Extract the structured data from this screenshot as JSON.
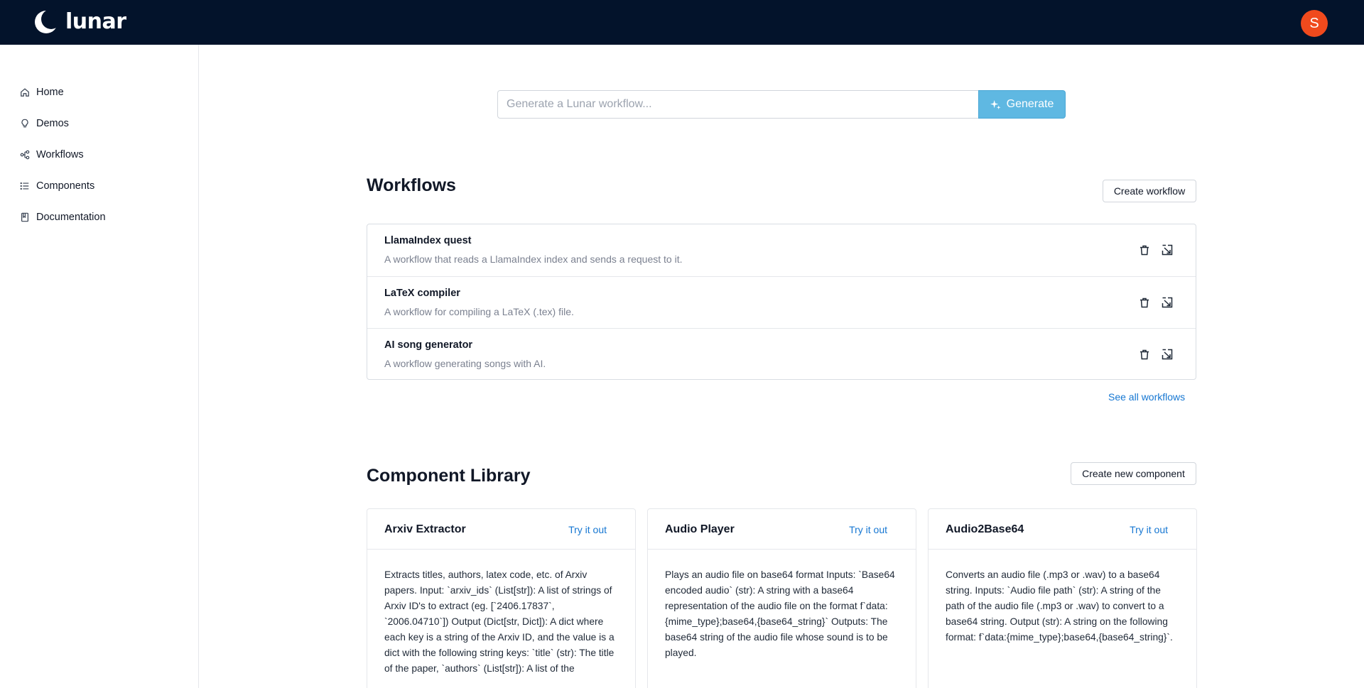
{
  "brand": {
    "name": "lunar"
  },
  "user": {
    "initial": "S"
  },
  "sidebar": {
    "items": [
      {
        "label": "Home",
        "icon": "home-icon"
      },
      {
        "label": "Demos",
        "icon": "lightbulb-icon"
      },
      {
        "label": "Workflows",
        "icon": "workflow-icon"
      },
      {
        "label": "Components",
        "icon": "list-icon"
      },
      {
        "label": "Documentation",
        "icon": "book-icon"
      }
    ]
  },
  "generator": {
    "placeholder": "Generate a Lunar workflow...",
    "button_label": "Generate"
  },
  "workflows": {
    "title": "Workflows",
    "create_label": "Create workflow",
    "see_all_label": "See all workflows",
    "items": [
      {
        "title": "LlamaIndex quest",
        "description": "A workflow that reads a LlamaIndex index and sends a request to it."
      },
      {
        "title": "LaTeX compiler",
        "description": "A workflow for compiling a LaTeX (.tex) file."
      },
      {
        "title": "AI song generator",
        "description": "A workflow generating songs with AI."
      }
    ]
  },
  "components": {
    "title": "Component Library",
    "create_label": "Create new component",
    "try_label": "Try it out",
    "items": [
      {
        "title": "Arxiv Extractor",
        "description": "Extracts titles, authors, latex code, etc. of Arxiv papers. Input: `arxiv_ids` (List[str]): A list of strings of Arxiv ID's to extract (eg. [`2406.17837`, `2006.04710`]) Output (Dict[str, Dict]): A dict where each key is a string of the Arxiv ID, and the value is a dict with the following string keys: `title` (str): The title of the paper, `authors` (List[str]): A list of the"
      },
      {
        "title": "Audio Player",
        "description": "Plays an audio file on base64 format Inputs: `Base64 encoded audio` (str): A string with a base64 representation of the audio file on the format f`data:{mime_type};base64,{base64_string}` Outputs: The base64 string of the audio file whose sound is to be played."
      },
      {
        "title": "Audio2Base64",
        "description": "Converts an audio file (.mp3 or .wav) to a base64 string. Inputs: `Audio file path` (str): A string of the path of the audio file (.mp3 or .wav) to convert to a base64 string. Output (str): A string on the following format: f`data:{mime_type};base64,{base64_string}`."
      }
    ]
  },
  "colors": {
    "topbar": "#03132b",
    "avatar": "#f04a1d",
    "accent": "#5fb8e2",
    "link": "#1677d2"
  }
}
